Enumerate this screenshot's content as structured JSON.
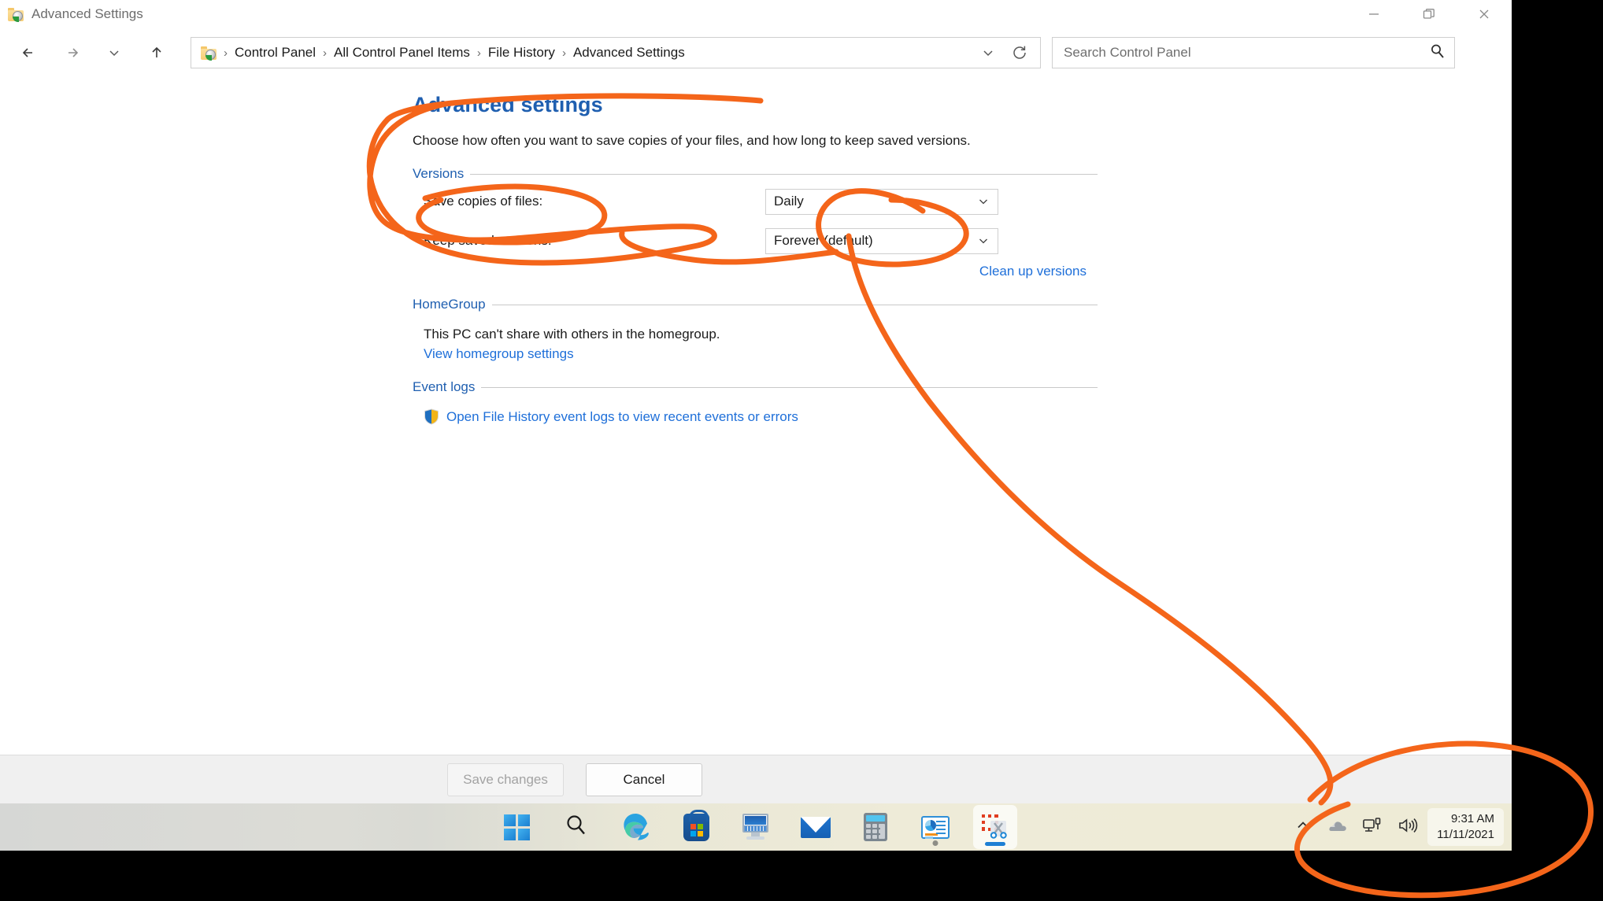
{
  "window": {
    "title": "Advanced Settings",
    "icon": "folder-settings-icon",
    "controls": {
      "minimize": "minimize-icon",
      "maximize": "restore-icon",
      "close": "close-icon"
    }
  },
  "toolbar": {
    "back": "back-arrow-icon",
    "forward": "forward-arrow-icon",
    "recent": "chevron-down-icon",
    "up": "up-arrow-icon",
    "breadcrumb": [
      "Control Panel",
      "All Control Panel Items",
      "File History",
      "Advanced Settings"
    ],
    "breadcrumb_separator": "›",
    "history_dropdown": "chevron-down-icon",
    "refresh": "refresh-icon"
  },
  "search": {
    "placeholder": "Search Control Panel",
    "value": "",
    "icon": "search-icon"
  },
  "page": {
    "title": "Advanced settings",
    "description": "Choose how often you want to save copies of your files, and how long to keep saved versions."
  },
  "versions": {
    "group_label": "Versions",
    "save_copies_label": "Save copies of files:",
    "save_copies_value": "Daily",
    "keep_saved_label": "Keep saved versions:",
    "keep_saved_value": "Forever (default)",
    "cleanup_link": "Clean up versions",
    "combo_arrow": "chevron-down-icon"
  },
  "homegroup": {
    "group_label": "HomeGroup",
    "status_text": "This PC can't share with others in the homegroup.",
    "settings_link": "View homegroup settings"
  },
  "event_logs": {
    "group_label": "Event logs",
    "link": "Open File History event logs to view recent events or errors",
    "icon": "shield-icon"
  },
  "footer": {
    "save_label": "Save changes",
    "save_disabled": true,
    "cancel_label": "Cancel"
  },
  "taskbar": {
    "items": [
      {
        "name": "start",
        "icon": "windows-logo-icon",
        "label": "Start",
        "running": false,
        "active": false
      },
      {
        "name": "search",
        "icon": "search-icon",
        "label": "Search",
        "running": false,
        "active": false
      },
      {
        "name": "edge",
        "icon": "edge-browser-icon",
        "label": "Microsoft Edge",
        "running": false,
        "active": false
      },
      {
        "name": "store",
        "icon": "microsoft-store-icon",
        "label": "Microsoft Store",
        "running": false,
        "active": false
      },
      {
        "name": "remote-desktop",
        "icon": "remote-desktop-icon",
        "label": "Remote Desktop Connection",
        "running": false,
        "active": false
      },
      {
        "name": "mail",
        "icon": "mail-envelope-icon",
        "label": "Mail",
        "running": false,
        "active": false
      },
      {
        "name": "calculator",
        "icon": "calculator-icon",
        "label": "Calculator",
        "running": false,
        "active": false
      },
      {
        "name": "dashboard",
        "icon": "dashboard-chart-icon",
        "label": "Dashboard",
        "running": true,
        "active": false
      },
      {
        "name": "snipping-tool",
        "icon": "snipping-tool-icon",
        "label": "Snipping Tool",
        "running": true,
        "active": true
      }
    ],
    "tray": {
      "overflow": "chevron-up-icon",
      "onedrive": "cloud-icon",
      "network": "network-icon",
      "volume": "speaker-icon",
      "time": "9:31 AM",
      "date": "11/11/2021"
    }
  },
  "annotation": {
    "color": "#f4651a",
    "stroke_width": 7,
    "marks": [
      {
        "name": "circle-around-title-and-label",
        "target": "Advanced settings / Save copies of files:"
      },
      {
        "name": "circle-around-save-copies-label",
        "target": "Save copies of files:"
      },
      {
        "name": "circle-around-daily-value",
        "target": "Daily"
      },
      {
        "name": "curve-to-tray",
        "target": "system tray chevron"
      },
      {
        "name": "circle-around-clock",
        "target": "9:31 AM 11/11/2021"
      }
    ]
  }
}
